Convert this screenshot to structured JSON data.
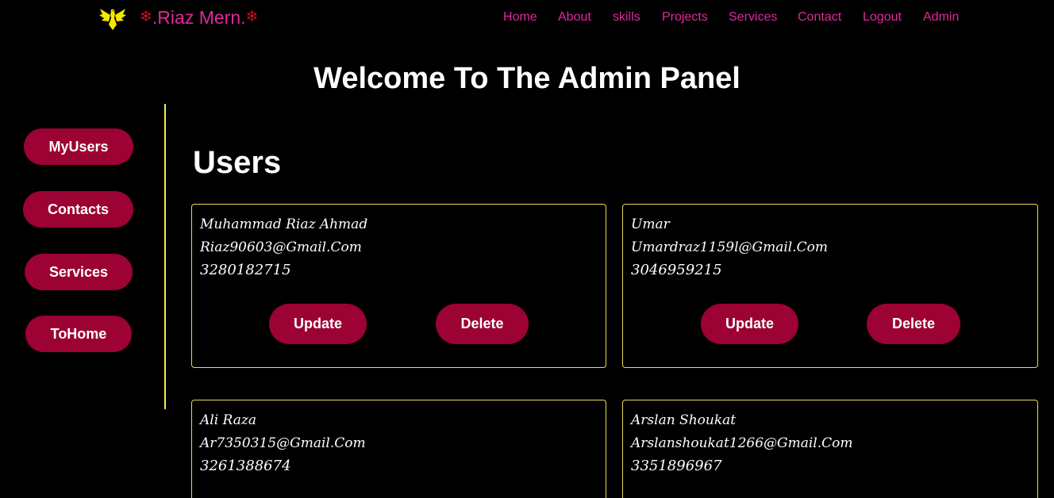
{
  "header": {
    "brand_text": ".Riaz Mern.",
    "brand_flake": "❄",
    "logo_icon": "eagle-icon",
    "nav": [
      "Home",
      "About",
      "skills",
      "Projects",
      "Services",
      "Contact",
      "Logout",
      "Admin"
    ]
  },
  "page_title": "Welcome To The Admin Panel",
  "sidebar": {
    "items": [
      "MyUsers",
      "Contacts",
      "Services",
      "ToHome"
    ]
  },
  "section_title": "Users",
  "users": [
    {
      "name": "Muhammad Riaz Ahmad",
      "email": "Riaz90603@Gmail.Com",
      "phone": "3280182715",
      "update_label": "Update",
      "delete_label": "Delete"
    },
    {
      "name": "Umar",
      "email": "Umardraz1159l@Gmail.Com",
      "phone": "3046959215",
      "update_label": "Update",
      "delete_label": "Delete"
    },
    {
      "name": "Ali Raza",
      "email": "Ar7350315@Gmail.Com",
      "phone": "3261388674"
    },
    {
      "name": "Arslan Shoukat",
      "email": "Arslanshoukat1266@Gmail.Com",
      "phone": "3351896967"
    }
  ],
  "colors": {
    "background": "#000000",
    "accent_pink": "#e0289b",
    "button_crimson": "#9c0233",
    "border_yellow": "#e8dc5a",
    "divider_yellow": "#f3e94a",
    "logo_yellow": "#f5e600"
  }
}
